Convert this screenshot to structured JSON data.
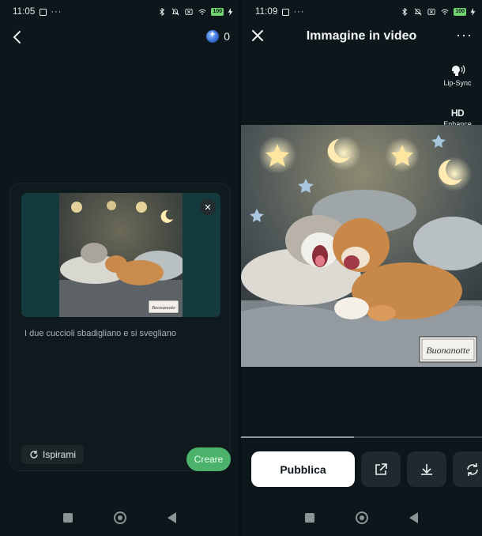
{
  "left": {
    "status": {
      "time": "11:05",
      "dots": "···",
      "battery": "100"
    },
    "credits": {
      "value": "0"
    },
    "prompt_text": "I due cuccioli sbadigliano e si svegliano",
    "inspire_label": "Ispirami",
    "create_label": "Creare",
    "thumb_watermark": "Buonanotte"
  },
  "right": {
    "status": {
      "time": "11:09",
      "dots": "···",
      "battery": "100"
    },
    "title": "Immagine in video",
    "more_label": "···",
    "tools": {
      "lipsync_label": "Lip-Sync",
      "enhance_label": "Enhance",
      "enhance_icon_text": "HD"
    },
    "watermark": "Buonanotte",
    "publish_label": "Pubblica",
    "progress": 0.47
  },
  "colors": {
    "accent_green": "#4bb26c",
    "background": "#0d171b",
    "battery_green": "#6fd36f"
  },
  "icons": [
    "back-icon",
    "credit-coin-icon",
    "close-icon",
    "refresh-icon",
    "share-icon",
    "download-icon",
    "regenerate-icon",
    "lip-sync-icon",
    "hd-icon",
    "more-icon"
  ]
}
